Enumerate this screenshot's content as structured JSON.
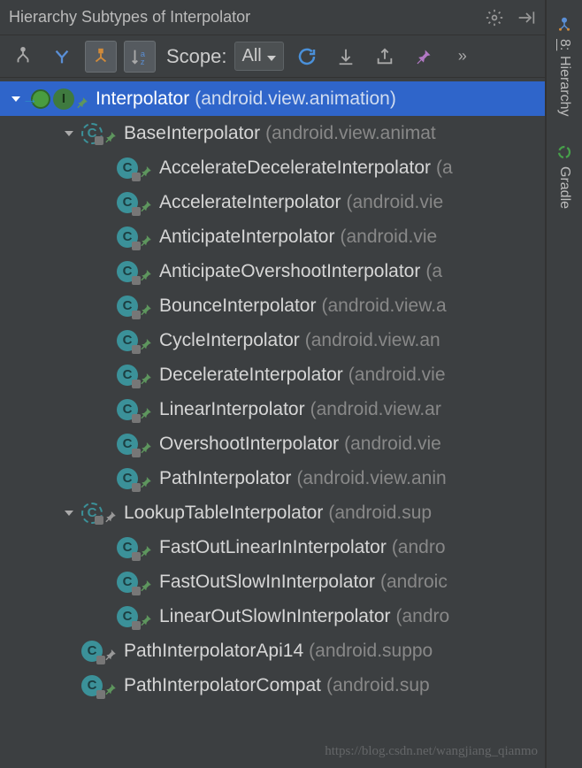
{
  "title": "Hierarchy Subtypes of Interpolator",
  "scope": {
    "label": "Scope:",
    "value": "All"
  },
  "rail": {
    "hierarchy": {
      "label": "Hierarchy",
      "prefix": "8:"
    },
    "gradle": {
      "label": "Gradle"
    }
  },
  "watermark": "https://blog.csdn.net/wangjiang_qianmo",
  "tree": [
    {
      "depth": 0,
      "arrow": "down",
      "kind": "interface",
      "jump": true,
      "name": "Interpolator",
      "pkg": "(android.view.animation)",
      "selected": true,
      "final": true
    },
    {
      "depth": 1,
      "arrow": "down",
      "kind": "class-abs",
      "name": "BaseInterpolator",
      "pkg": "(android.view.animat",
      "final": true
    },
    {
      "depth": 2,
      "arrow": "",
      "kind": "class",
      "name": "AccelerateDecelerateInterpolator",
      "pkg": "(a",
      "final": true
    },
    {
      "depth": 2,
      "arrow": "",
      "kind": "class",
      "name": "AccelerateInterpolator",
      "pkg": "(android.vie",
      "final": true
    },
    {
      "depth": 2,
      "arrow": "",
      "kind": "class",
      "name": "AnticipateInterpolator",
      "pkg": "(android.vie",
      "final": true
    },
    {
      "depth": 2,
      "arrow": "",
      "kind": "class",
      "name": "AnticipateOvershootInterpolator",
      "pkg": "(a",
      "final": true
    },
    {
      "depth": 2,
      "arrow": "",
      "kind": "class",
      "name": "BounceInterpolator",
      "pkg": "(android.view.a",
      "final": true
    },
    {
      "depth": 2,
      "arrow": "",
      "kind": "class",
      "name": "CycleInterpolator",
      "pkg": "(android.view.an",
      "final": true
    },
    {
      "depth": 2,
      "arrow": "",
      "kind": "class",
      "name": "DecelerateInterpolator",
      "pkg": "(android.vie",
      "final": true
    },
    {
      "depth": 2,
      "arrow": "",
      "kind": "class",
      "name": "LinearInterpolator",
      "pkg": "(android.view.ar",
      "final": true
    },
    {
      "depth": 2,
      "arrow": "",
      "kind": "class",
      "name": "OvershootInterpolator",
      "pkg": "(android.vie",
      "final": true
    },
    {
      "depth": 2,
      "arrow": "",
      "kind": "class",
      "name": "PathInterpolator",
      "pkg": "(android.view.anin",
      "final": true
    },
    {
      "depth": 1,
      "arrow": "down",
      "kind": "class-abs",
      "name": "LookupTableInterpolator",
      "pkg": "(android.sup",
      "final": false
    },
    {
      "depth": 2,
      "arrow": "",
      "kind": "class",
      "name": "FastOutLinearInInterpolator",
      "pkg": "(andro",
      "final": true
    },
    {
      "depth": 2,
      "arrow": "",
      "kind": "class",
      "name": "FastOutSlowInInterpolator",
      "pkg": "(androic",
      "final": true
    },
    {
      "depth": 2,
      "arrow": "",
      "kind": "class",
      "name": "LinearOutSlowInInterpolator",
      "pkg": "(andro",
      "final": true
    },
    {
      "depth": 1,
      "arrow": "",
      "kind": "class",
      "name": "PathInterpolatorApi14",
      "pkg": "(android.suppo",
      "final": false
    },
    {
      "depth": 1,
      "arrow": "",
      "kind": "class",
      "name": "PathInterpolatorCompat",
      "pkg": "(android.sup",
      "final": true
    }
  ]
}
